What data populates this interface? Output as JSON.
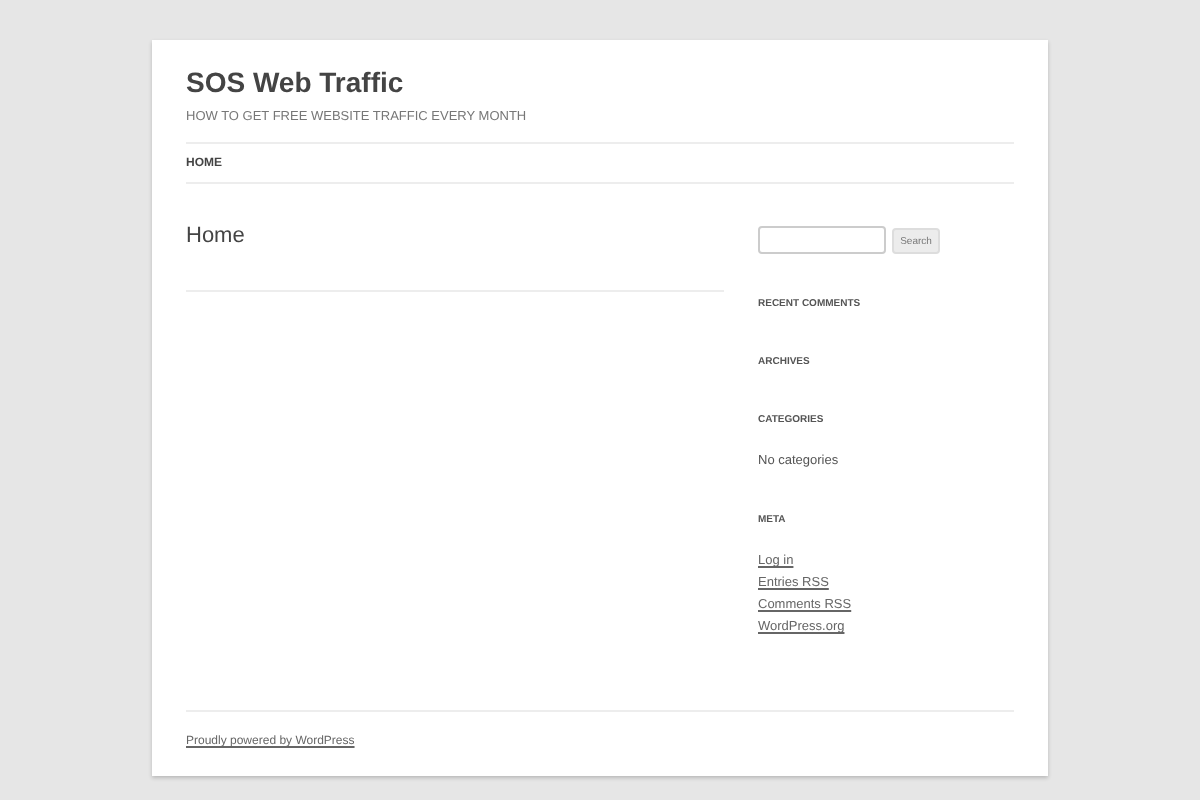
{
  "site": {
    "title": "SOS Web Traffic",
    "tagline": "HOW TO GET FREE WEBSITE TRAFFIC EVERY MONTH"
  },
  "nav": [
    {
      "label": "HOME",
      "selected": true
    }
  ],
  "main": {
    "page_title": "Home"
  },
  "sidebar": {
    "search": {
      "button": "Search"
    },
    "widgets": [
      {
        "title": "RECENT COMMENTS"
      },
      {
        "title": "ARCHIVES"
      },
      {
        "title": "CATEGORIES",
        "items": [
          {
            "text": "No categories",
            "kind": "text"
          }
        ]
      },
      {
        "title": "META",
        "items": [
          {
            "text": "Log in",
            "kind": "link"
          },
          {
            "text": "Entries RSS",
            "kind": "link"
          },
          {
            "text": "Comments RSS",
            "kind": "link"
          },
          {
            "text": "WordPress.org",
            "kind": "link"
          }
        ]
      }
    ]
  },
  "footer": {
    "credit": "Proudly powered by WordPress"
  }
}
